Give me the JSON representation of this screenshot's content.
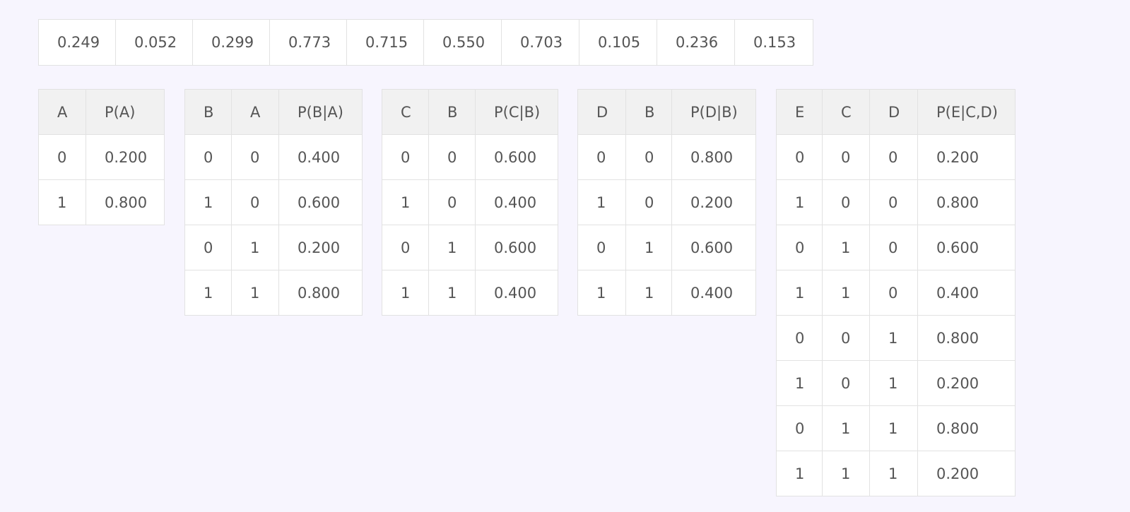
{
  "samples": [
    "0.249",
    "0.052",
    "0.299",
    "0.773",
    "0.715",
    "0.550",
    "0.703",
    "0.105",
    "0.236",
    "0.153"
  ],
  "cpts": [
    {
      "id": "t-a",
      "headers": [
        "A",
        "P(A)"
      ],
      "col_widths": [],
      "rows": [
        [
          "0",
          "0.200"
        ],
        [
          "1",
          "0.800"
        ]
      ]
    },
    {
      "id": "t-b",
      "headers": [
        "B",
        "A",
        "P(B|A)"
      ],
      "rows": [
        [
          "0",
          "0",
          "0.400"
        ],
        [
          "1",
          "0",
          "0.600"
        ],
        [
          "0",
          "1",
          "0.200"
        ],
        [
          "1",
          "1",
          "0.800"
        ]
      ]
    },
    {
      "id": "t-c",
      "headers": [
        "C",
        "B",
        "P(C|B)"
      ],
      "rows": [
        [
          "0",
          "0",
          "0.600"
        ],
        [
          "1",
          "0",
          "0.400"
        ],
        [
          "0",
          "1",
          "0.600"
        ],
        [
          "1",
          "1",
          "0.400"
        ]
      ]
    },
    {
      "id": "t-d",
      "headers": [
        "D",
        "B",
        "P(D|B)"
      ],
      "rows": [
        [
          "0",
          "0",
          "0.800"
        ],
        [
          "1",
          "0",
          "0.200"
        ],
        [
          "0",
          "1",
          "0.600"
        ],
        [
          "1",
          "1",
          "0.400"
        ]
      ]
    },
    {
      "id": "t-e",
      "headers": [
        "E",
        "C",
        "D",
        "P(E|C,D)"
      ],
      "rows": [
        [
          "0",
          "0",
          "0",
          "0.200"
        ],
        [
          "1",
          "0",
          "0",
          "0.800"
        ],
        [
          "0",
          "1",
          "0",
          "0.600"
        ],
        [
          "1",
          "1",
          "0",
          "0.400"
        ],
        [
          "0",
          "0",
          "1",
          "0.800"
        ],
        [
          "1",
          "0",
          "1",
          "0.200"
        ],
        [
          "0",
          "1",
          "1",
          "0.800"
        ],
        [
          "1",
          "1",
          "1",
          "0.200"
        ]
      ]
    }
  ]
}
